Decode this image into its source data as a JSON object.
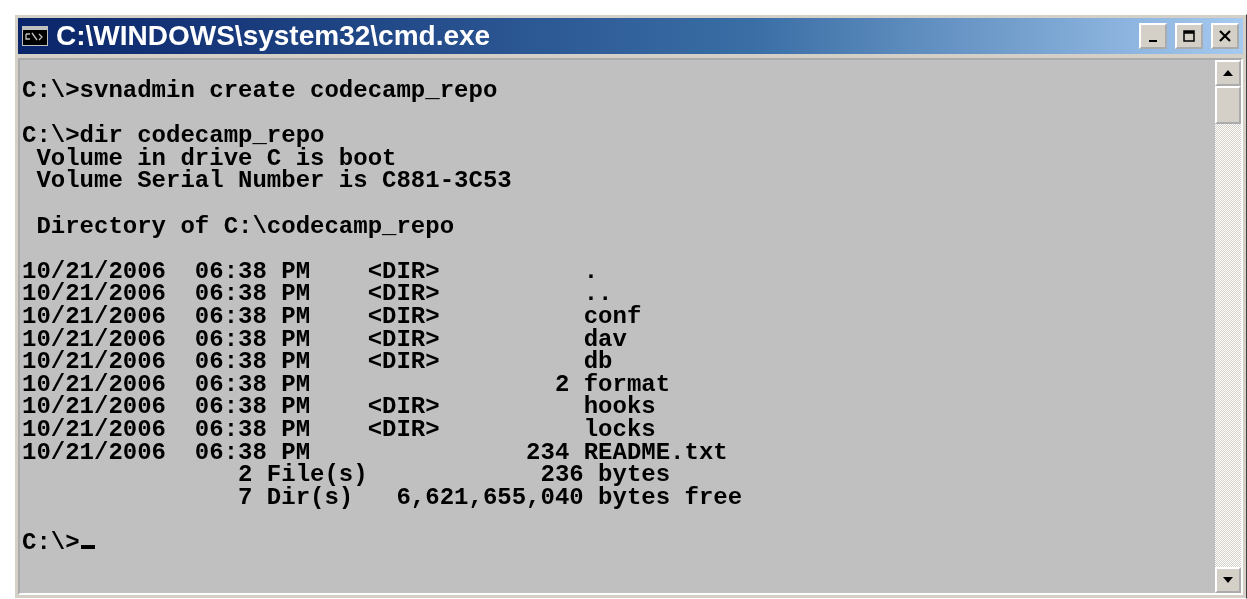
{
  "window": {
    "title": "C:\\WINDOWS\\system32\\cmd.exe"
  },
  "console": {
    "groups": [
      [
        "C:\\>svnadmin create codecamp_repo"
      ],
      [
        "C:\\>dir codecamp_repo",
        " Volume in drive C is boot",
        " Volume Serial Number is C881-3C53"
      ],
      [
        " Directory of C:\\codecamp_repo"
      ],
      [
        "10/21/2006  06:38 PM    <DIR>          .",
        "10/21/2006  06:38 PM    <DIR>          ..",
        "10/21/2006  06:38 PM    <DIR>          conf",
        "10/21/2006  06:38 PM    <DIR>          dav",
        "10/21/2006  06:38 PM    <DIR>          db",
        "10/21/2006  06:38 PM                 2 format",
        "10/21/2006  06:38 PM    <DIR>          hooks",
        "10/21/2006  06:38 PM    <DIR>          locks",
        "10/21/2006  06:38 PM               234 README.txt",
        "               2 File(s)            236 bytes",
        "               7 Dir(s)   6,621,655,040 bytes free"
      ],
      [
        "C:\\>"
      ]
    ],
    "cursor_visible": true
  }
}
